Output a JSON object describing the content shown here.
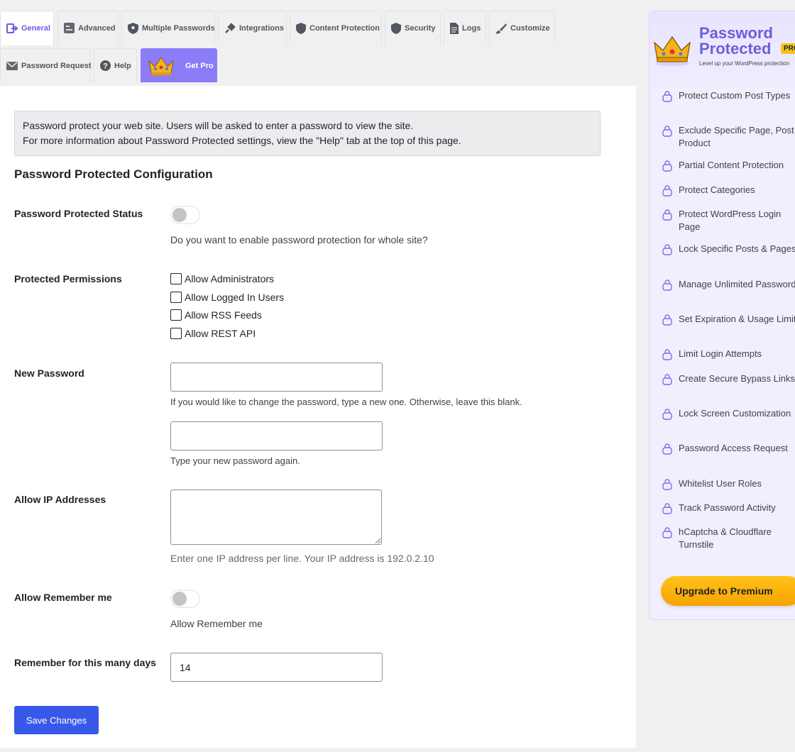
{
  "tabs": [
    {
      "label": "General",
      "icon": "general-icon"
    },
    {
      "label": "Advanced",
      "icon": "advanced-icon"
    },
    {
      "label": "Multiple Passwords",
      "icon": "shield-key-icon"
    },
    {
      "label": "Integrations",
      "icon": "plug-icon"
    },
    {
      "label": "Content Protection",
      "icon": "shield-icon"
    },
    {
      "label": "Security",
      "icon": "shield-icon"
    },
    {
      "label": "Logs",
      "icon": "document-icon"
    },
    {
      "label": "Customize",
      "icon": "brush-icon"
    },
    {
      "label": "Password Request",
      "icon": "envelope-icon"
    },
    {
      "label": "Help",
      "icon": "help-icon"
    },
    {
      "label": "Get Pro",
      "icon": "crown-icon"
    }
  ],
  "notice": {
    "line1": "Password protect your web site. Users will be asked to enter a password to view the site.",
    "line2": "For more information about Password Protected settings, view the \"Help\" tab at the top of this page."
  },
  "section_title": "Password Protected Configuration",
  "fields": {
    "status": {
      "label": "Password Protected Status",
      "desc": "Do you want to enable password protection for whole site?",
      "enabled": false
    },
    "permissions": {
      "label": "Protected Permissions",
      "options": [
        "Allow Administrators",
        "Allow Logged In Users",
        "Allow RSS Feeds",
        "Allow REST API"
      ]
    },
    "new_password": {
      "label": "New Password",
      "desc1": "If you would like to change the password, type a new one. Otherwise, leave this blank.",
      "desc2": "Type your new password again.",
      "value1": "",
      "value2": ""
    },
    "allow_ip": {
      "label": "Allow IP Addresses",
      "desc": "Enter one IP address per line. Your IP address is 192.0.2.10"
    },
    "remember": {
      "label": "Allow Remember me",
      "desc": "Allow Remember me",
      "enabled": false
    },
    "remember_days": {
      "label": "Remember for this many days",
      "value": "14"
    }
  },
  "save_label": "Save Changes",
  "sidebar": {
    "title": "Password Protected",
    "badge": "PRO",
    "tagline": "Level up your WordPress protection",
    "features": [
      "Protect Custom Post Types",
      "Exclude Specific Page, Post & Product",
      "Partial Content Protection",
      "Protect Categories",
      "Protect WordPress Login Page",
      "Lock Specific Posts & Pages",
      "Manage Unlimited Passwords",
      "Set Expiration & Usage Limits",
      "Limit Login Attempts",
      "Create Secure Bypass Links",
      "Lock Screen Customization",
      "Password Access Request",
      "Whitelist User Roles",
      "Track Password Activity",
      "hCaptcha & Cloudflare Turnstile"
    ],
    "upgrade_label": "Upgrade to Premium"
  },
  "colors": {
    "accent": "#6a5ee6",
    "primary_button": "#3858e9",
    "get_pro_tab": "#8b7cf7",
    "upgrade_button": "#ffb30f",
    "sidebar_bg": "#f1eefe"
  }
}
